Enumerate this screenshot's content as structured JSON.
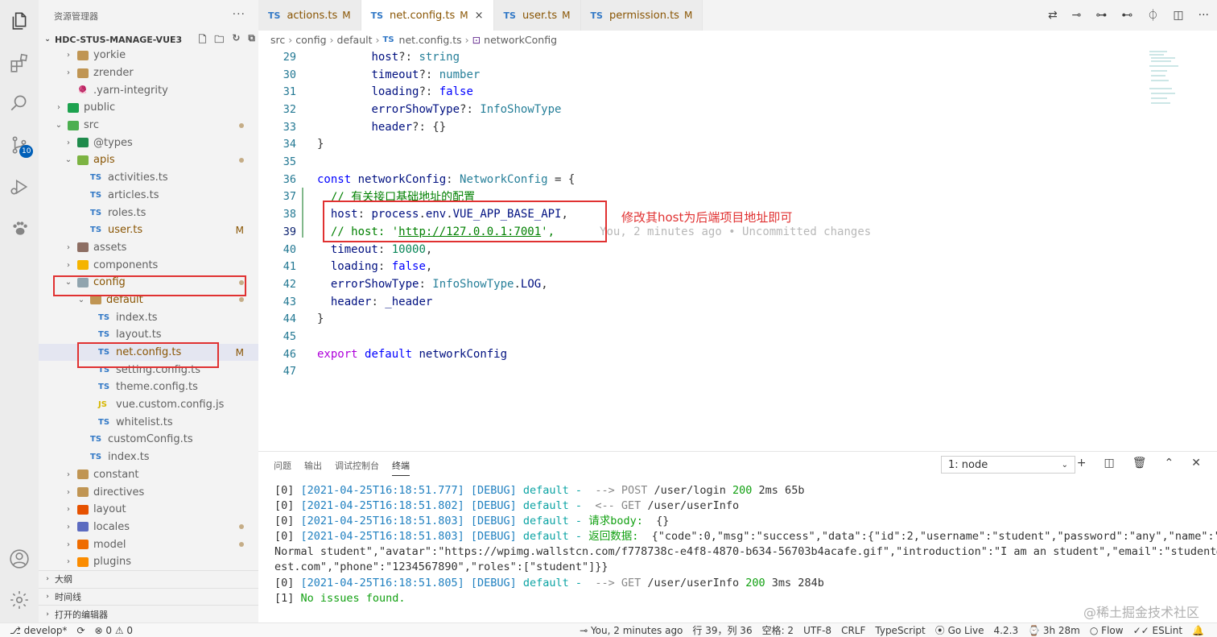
{
  "activity_bar": {
    "scm_badge": "10"
  },
  "sidebar": {
    "title": "资源管理器",
    "more": "···",
    "project": "HDC-STUS-MANAGE-VUE3",
    "tree": [
      {
        "name": "yorkie",
        "icon": "folder",
        "indent": 1,
        "twist": "›"
      },
      {
        "name": "zrender",
        "icon": "folder",
        "indent": 1,
        "twist": "›"
      },
      {
        "name": ".yarn-integrity",
        "icon": "file-yarn",
        "indent": 1,
        "twist": ""
      },
      {
        "name": "public",
        "icon": "folder-public",
        "indent": 0,
        "twist": "›"
      },
      {
        "name": "src",
        "icon": "folder-src",
        "indent": 0,
        "twist": "⌄",
        "dot": true
      },
      {
        "name": "@types",
        "icon": "folder-types",
        "indent": 1,
        "twist": "›"
      },
      {
        "name": "apis",
        "icon": "folder-api",
        "indent": 1,
        "twist": "⌄",
        "dot": true,
        "modified": true
      },
      {
        "name": "activities.ts",
        "icon": "ts",
        "indent": 2,
        "twist": ""
      },
      {
        "name": "articles.ts",
        "icon": "ts",
        "indent": 2,
        "twist": ""
      },
      {
        "name": "roles.ts",
        "icon": "ts",
        "indent": 2,
        "twist": ""
      },
      {
        "name": "user.ts",
        "icon": "ts",
        "indent": 2,
        "twist": "",
        "badge": "M",
        "modified": true
      },
      {
        "name": "assets",
        "icon": "folder-assets",
        "indent": 1,
        "twist": "›"
      },
      {
        "name": "components",
        "icon": "folder-components",
        "indent": 1,
        "twist": "›"
      },
      {
        "name": "config",
        "icon": "folder-config",
        "indent": 1,
        "twist": "⌄",
        "dot": true,
        "modified": true
      },
      {
        "name": "default",
        "icon": "folder",
        "indent": 2,
        "twist": "⌄",
        "dot": true,
        "modified": true
      },
      {
        "name": "index.ts",
        "icon": "ts",
        "indent": 3,
        "twist": ""
      },
      {
        "name": "layout.ts",
        "icon": "ts",
        "indent": 3,
        "twist": ""
      },
      {
        "name": "net.config.ts",
        "icon": "ts",
        "indent": 3,
        "twist": "",
        "badge": "M",
        "selected": true,
        "modified": true
      },
      {
        "name": "setting.config.ts",
        "icon": "ts",
        "indent": 3,
        "twist": ""
      },
      {
        "name": "theme.config.ts",
        "icon": "ts",
        "indent": 3,
        "twist": ""
      },
      {
        "name": "vue.custom.config.js",
        "icon": "js",
        "indent": 3,
        "twist": ""
      },
      {
        "name": "whitelist.ts",
        "icon": "ts",
        "indent": 3,
        "twist": ""
      },
      {
        "name": "customConfig.ts",
        "icon": "ts",
        "indent": 2,
        "twist": ""
      },
      {
        "name": "index.ts",
        "icon": "ts",
        "indent": 2,
        "twist": ""
      },
      {
        "name": "constant",
        "icon": "folder",
        "indent": 1,
        "twist": "›"
      },
      {
        "name": "directives",
        "icon": "folder",
        "indent": 1,
        "twist": "›"
      },
      {
        "name": "layout",
        "icon": "folder-layout",
        "indent": 1,
        "twist": "›"
      },
      {
        "name": "locales",
        "icon": "folder-locales",
        "indent": 1,
        "twist": "›",
        "dot": true
      },
      {
        "name": "model",
        "icon": "folder-model",
        "indent": 1,
        "twist": "›",
        "dot": true
      },
      {
        "name": "plugins",
        "icon": "folder-plugins",
        "indent": 1,
        "twist": "›"
      }
    ],
    "bottom_panels": [
      "大纲",
      "时间线",
      "打开的编辑器"
    ]
  },
  "tabs": [
    {
      "label": "actions.ts",
      "badge": "M",
      "active": false
    },
    {
      "label": "net.config.ts",
      "badge": "M",
      "active": true
    },
    {
      "label": "user.ts",
      "badge": "M",
      "active": false
    },
    {
      "label": "permission.ts",
      "badge": "M",
      "active": false
    }
  ],
  "breadcrumb": [
    "src",
    "config",
    "default",
    "net.config.ts",
    "networkConfig"
  ],
  "code": {
    "lines": [
      29,
      30,
      31,
      32,
      33,
      34,
      35,
      36,
      37,
      38,
      39,
      40,
      41,
      42,
      43,
      44,
      45,
      46,
      47
    ],
    "current_line": 39,
    "blame": "You, 2 minutes ago • Uncommitted changes"
  },
  "annotation": {
    "text": "修改其host为后端项目地址即可"
  },
  "panel": {
    "tabs": [
      "问题",
      "输出",
      "调试控制台",
      "终端"
    ],
    "active_tab": "终端",
    "terminal_select": "1: node",
    "terminal_lines": [
      {
        "prefix": "[0] ",
        "ts": "[2021-04-25T16:18:51.777]",
        "lvl": "[DEBUG]",
        "cat": "default -",
        "arrow": "  --> ",
        "method": "POST",
        "path": " /user/login ",
        "code": "200",
        "rest": " 2ms 65b"
      },
      {
        "prefix": "[0] ",
        "ts": "[2021-04-25T16:18:51.802]",
        "lvl": "[DEBUG]",
        "cat": "default -",
        "arrow": "  <-- ",
        "method": "GET",
        "path": " /user/userInfo",
        "code": "",
        "rest": ""
      },
      {
        "prefix": "[0] ",
        "ts": "[2021-04-25T16:18:51.803]",
        "lvl": "[DEBUG]",
        "cat": "default -",
        "arrow": " ",
        "method": "",
        "path": "",
        "code": "",
        "rest": "",
        "cn": "请求body:",
        "body": "  {}"
      },
      {
        "prefix": "[0] ",
        "ts": "[2021-04-25T16:18:51.803]",
        "lvl": "[DEBUG]",
        "cat": "default -",
        "arrow": " ",
        "method": "",
        "path": "",
        "code": "",
        "rest": "",
        "cn": "返回数据:",
        "body": "  {\"code\":0,\"msg\":\"success\",\"data\":{\"id\":2,\"username\":\"student\",\"password\":\"any\",\"name\":\""
      }
    ],
    "terminal_wrap": [
      "Normal student\",\"avatar\":\"https://wpimg.wallstcn.com/f778738c-e4f8-4870-b634-56703b4acafe.gif\",\"introduction\":\"I am an student\",\"email\":\"student@t",
      "est.com\",\"phone\":\"1234567890\",\"roles\":[\"student\"]}}"
    ],
    "terminal_after": [
      {
        "prefix": "[0] ",
        "ts": "[2021-04-25T16:18:51.805]",
        "lvl": "[DEBUG]",
        "cat": "default -",
        "arrow": "  --> ",
        "method": "GET",
        "path": " /user/userInfo ",
        "code": "200",
        "rest": " 3ms 284b"
      }
    ],
    "final_line": {
      "prefix": "[1] ",
      "text": "No issues found."
    }
  },
  "watermark": "@稀土掘金技术社区",
  "status_bar": {
    "branch": "develop*",
    "errors": "0",
    "warnings": "0",
    "blame": "You, 2 minutes ago",
    "position": "行 39，列 36",
    "spaces": "空格: 2",
    "encoding": "UTF-8",
    "eol": "CRLF",
    "language": "TypeScript",
    "go_live": "Go Live",
    "version": "4.2.3",
    "time": "3h 28m",
    "flow": "Flow",
    "eslint": "ESLint"
  },
  "colors": {
    "accent": "#005fb8",
    "annotation_red": "#e03131",
    "modified": "#895503"
  }
}
